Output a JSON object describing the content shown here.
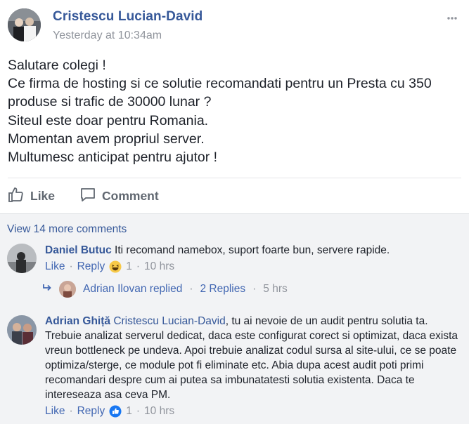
{
  "post": {
    "author": "Cristescu Lucian-David",
    "time": "Yesterday at 10:34am",
    "lines": [
      "Salutare colegi !",
      "Ce firma de hosting si ce solutie recomandati pentru un Presta cu 350",
      "produse si trafic de 30000 lunar ?",
      "Siteul este doar pentru Romania.",
      "Momentan avem propriul server.",
      "Multumesc anticipat pentru ajutor !"
    ]
  },
  "actions": {
    "like": "Like",
    "comment": "Comment"
  },
  "comments_section": {
    "view_more": "View 14 more comments",
    "comments": [
      {
        "author": "Daniel Butuc",
        "text": "Iti recomand namebox, suport foarte bun, servere rapide.",
        "like": "Like",
        "reply": "Reply",
        "reaction_count": "1",
        "time": "10 hrs",
        "reaction_icon": "haha-reaction-icon"
      },
      {
        "author": "Adrian Ghiță",
        "mention": "Cristescu Lucian-David",
        "text": ", tu ai nevoie de un audit pentru solutia ta. Trebuie analizat serverul dedicat, daca este configurat corect si optimizat, daca exista vreun bottleneck pe undeva. Apoi trebuie analizat codul sursa al site-ului, ce se poate optimiza/sterge, ce module pot fi eliminate etc. Abia dupa acest audit poti primi recomandari despre cum ai putea sa imbunatatesti solutia existenta. Daca te intereseaza asa ceva PM.",
        "like": "Like",
        "reply": "Reply",
        "reaction_count": "1",
        "time": "10 hrs",
        "reaction_icon": "like-reaction-icon"
      }
    ],
    "reply_summary": {
      "name": "Adrian Ilovan replied",
      "replies": "2 Replies",
      "time": "5 hrs"
    }
  },
  "colors": {
    "link": "#365899",
    "action_link": "#4267b2",
    "meta": "#90949c",
    "comments_bg": "#f2f3f5"
  }
}
